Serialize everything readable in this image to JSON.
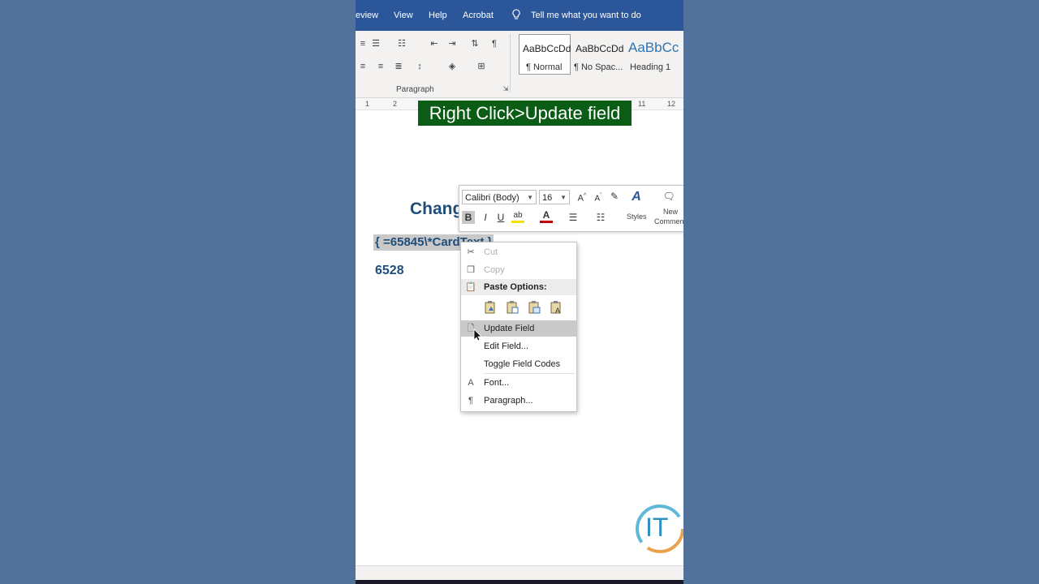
{
  "titlebar": {
    "menu": [
      "eview",
      "View",
      "Help",
      "Acrobat"
    ],
    "tell_me": "Tell me what you want to do"
  },
  "ribbon": {
    "paragraph_group_label": "Paragraph",
    "styles": [
      {
        "sample": "AaBbCcDd",
        "name": "¶ Normal"
      },
      {
        "sample": "AaBbCcDd",
        "name": "¶ No Spac..."
      },
      {
        "sample": "AaBbCc",
        "name": "Heading 1"
      }
    ]
  },
  "ruler": {
    "ticks": [
      "1",
      "2",
      "11",
      "12"
    ]
  },
  "caption": "Right Click>Update field",
  "document": {
    "heading_fragment": "Chang",
    "field_code": "{ =65845\\*CardText }",
    "result": "6528"
  },
  "mini_toolbar": {
    "font": "Calibri (Body)",
    "size": "16",
    "styles_label": "Styles",
    "new_comment_label": [
      "New",
      "Commen"
    ]
  },
  "context_menu": {
    "cut": "Cut",
    "copy": "Copy",
    "paste_options": "Paste Options:",
    "update_field": "Update Field",
    "edit_field": "Edit Field...",
    "toggle_field_codes": "Toggle Field Codes",
    "font": "Font...",
    "paragraph": "Paragraph..."
  },
  "logo_text": "IT",
  "colors": {
    "background": "#52729b",
    "titlebar": "#2b579a",
    "caption_bg": "#0b5d15",
    "doc_text": "#1f4e79"
  }
}
